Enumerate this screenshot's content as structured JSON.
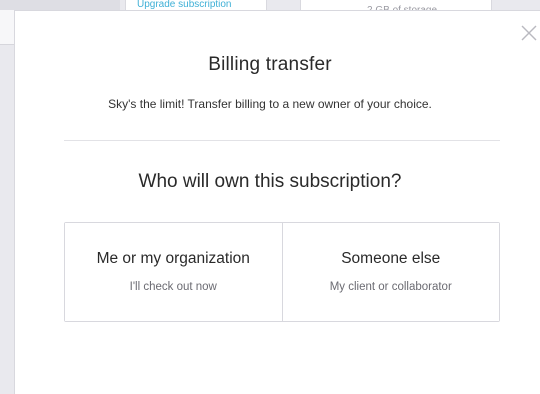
{
  "background": {
    "upgrade_link": "Upgrade subscription",
    "storage_text": "2 GB of storage"
  },
  "modal": {
    "close_icon": "close-icon",
    "title": "Billing transfer",
    "subtitle": "Sky's the limit! Transfer billing to a new owner of your choice.",
    "question": "Who will own this subscription?",
    "options": [
      {
        "title": "Me or my organization",
        "description": "I'll check out now"
      },
      {
        "title": "Someone else",
        "description": "My client or collaborator"
      }
    ]
  },
  "colors": {
    "link": "#3fb0d6",
    "border": "#d8d8de",
    "text": "#2a2a2a",
    "muted_text": "#6b6b72"
  }
}
